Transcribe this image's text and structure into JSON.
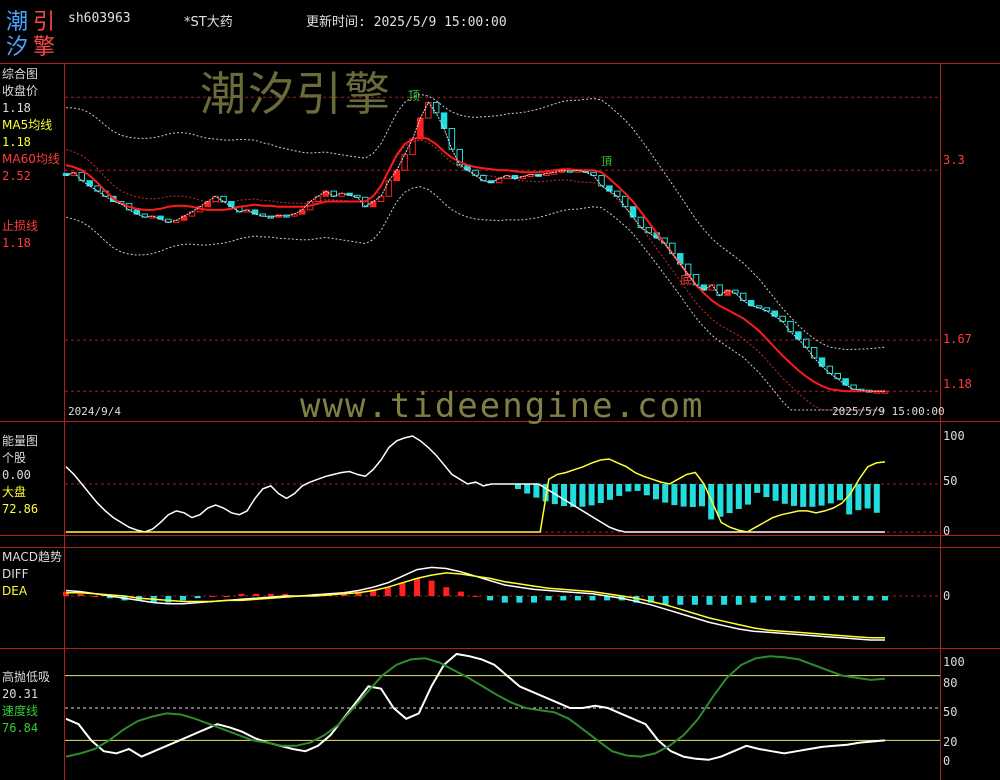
{
  "header": {
    "logo_chars": [
      "潮",
      "引",
      "汐",
      "擎"
    ],
    "symbol": "sh603963",
    "name": "*ST大药",
    "update_label": "更新时间: 2025/5/9 15:00:00"
  },
  "watermark": {
    "cn": "潮汐引擎",
    "url": "www.tideengine.com"
  },
  "main_panel": {
    "title": "综合图",
    "close_label": "收盘价",
    "close_value": "1.18",
    "ma5_label": "MA5均线",
    "ma5_value": "1.18",
    "ma60_label": "MA60均线",
    "ma60_value": "2.52",
    "stop_label": "止损线",
    "stop_value": "1.18",
    "axis_labels": [
      "3.3",
      "1.67",
      "1.18"
    ],
    "date_start": "2024/9/4",
    "date_end": "2025/5/9 15:00:00",
    "marker_top": "顶",
    "marker_bottom": "底",
    "marker_mid": "頂"
  },
  "energy_panel": {
    "title": "能量图",
    "stock_label": "个股",
    "stock_value": "0.00",
    "market_label": "大盘",
    "market_value": "72.86",
    "axis_labels": [
      "100",
      "50",
      "0"
    ]
  },
  "macd_panel": {
    "title": "MACD趋势",
    "diff_label": "DIFF",
    "dea_label": "DEA",
    "axis_labels": [
      "0"
    ]
  },
  "hl_panel": {
    "title": "高抛低吸",
    "value": "20.31",
    "speed_label": "速度线",
    "speed_value": "76.84",
    "axis_labels": [
      "100",
      "80",
      "50",
      "20",
      "0"
    ]
  },
  "colors": {
    "up": "#ff2020",
    "down": "#22dddd",
    "ma60": "#ff1a1a",
    "ma5": "#ffffff",
    "yellow": "#ffff33",
    "green": "#2e8b2e",
    "grid": "#a02020"
  },
  "chart_data": [
    {
      "type": "candlestick",
      "title": "综合图",
      "x_start": "2024/9/4",
      "x_end": "2025/5/9",
      "ylim": [
        1.0,
        4.3
      ],
      "close": [
        3.25,
        3.28,
        3.2,
        3.15,
        3.1,
        3.05,
        3.0,
        2.98,
        2.92,
        2.88,
        2.85,
        2.86,
        2.83,
        2.8,
        2.82,
        2.86,
        2.9,
        2.95,
        3.0,
        3.05,
        3.0,
        2.95,
        2.9,
        2.92,
        2.88,
        2.86,
        2.85,
        2.87,
        2.86,
        2.88,
        2.92,
        3.0,
        3.05,
        3.1,
        3.05,
        3.08,
        3.06,
        3.04,
        2.95,
        3.0,
        3.05,
        3.2,
        3.3,
        3.45,
        3.6,
        3.8,
        3.95,
        3.85,
        3.7,
        3.5,
        3.35,
        3.3,
        3.25,
        3.2,
        3.18,
        3.22,
        3.25,
        3.22,
        3.24,
        3.26,
        3.25,
        3.27,
        3.28,
        3.3,
        3.29,
        3.3,
        3.28,
        3.25,
        3.15,
        3.1,
        3.05,
        2.95,
        2.85,
        2.75,
        2.7,
        2.65,
        2.6,
        2.5,
        2.4,
        2.3,
        2.2,
        2.15,
        2.2,
        2.1,
        2.15,
        2.12,
        2.05,
        2.0,
        1.98,
        1.95,
        1.9,
        1.85,
        1.75,
        1.68,
        1.6,
        1.5,
        1.42,
        1.35,
        1.3,
        1.24,
        1.2,
        1.19,
        1.18,
        1.18,
        1.18
      ],
      "ma60": [
        3.35,
        3.33,
        3.3,
        3.25,
        3.18,
        3.1,
        3.03,
        2.98,
        2.95,
        2.93,
        2.92,
        2.92,
        2.93,
        2.95,
        2.96,
        2.96,
        2.95,
        2.93,
        2.92,
        2.92,
        2.92,
        2.93,
        2.95,
        2.96,
        2.97,
        2.96,
        2.96,
        2.95,
        2.95,
        2.95,
        2.95,
        2.96,
        2.98,
        3.0,
        3.0,
        3.0,
        3.0,
        3.0,
        3.0,
        3.05,
        3.15,
        3.3,
        3.45,
        3.55,
        3.6,
        3.62,
        3.6,
        3.55,
        3.48,
        3.42,
        3.38,
        3.35,
        3.33,
        3.32,
        3.31,
        3.3,
        3.3,
        3.29,
        3.28,
        3.28,
        3.28,
        3.29,
        3.3,
        3.31,
        3.31,
        3.3,
        3.3,
        3.3,
        3.28,
        3.22,
        3.15,
        3.08,
        3.0,
        2.9,
        2.8,
        2.7,
        2.6,
        2.5,
        2.4,
        2.3,
        2.2,
        2.12,
        2.05,
        2.0,
        1.96,
        1.92,
        1.88,
        1.82,
        1.76,
        1.68,
        1.6,
        1.52,
        1.45,
        1.38,
        1.32,
        1.27,
        1.23,
        1.2,
        1.19,
        1.18,
        1.18,
        1.18,
        1.18,
        1.18,
        1.18
      ],
      "upper_band_start": 4.0,
      "stop_line": 1.18,
      "reference_levels": [
        3.3,
        1.67,
        1.18
      ]
    },
    {
      "type": "line",
      "title": "能量图",
      "ylim": [
        0,
        100
      ],
      "series": [
        {
          "name": "个股",
          "values": [
            68,
            60,
            50,
            40,
            30,
            22,
            15,
            10,
            5,
            2,
            0,
            3,
            10,
            18,
            22,
            20,
            15,
            18,
            25,
            28,
            25,
            20,
            18,
            22,
            35,
            45,
            48,
            40,
            35,
            40,
            48,
            52,
            55,
            58,
            60,
            62,
            63,
            60,
            58,
            65,
            75,
            88,
            95,
            98,
            100,
            95,
            88,
            80,
            70,
            60,
            55,
            50,
            52,
            48,
            50,
            50,
            50,
            50,
            50,
            50,
            50,
            45,
            40,
            35,
            30,
            25,
            20,
            15,
            10,
            5,
            2,
            0,
            0,
            0,
            0,
            0,
            0,
            0,
            0,
            0,
            0,
            0,
            0,
            0,
            0,
            0,
            0,
            0,
            0,
            0,
            0,
            0,
            0,
            0,
            0,
            0,
            0,
            0,
            0,
            0,
            0,
            0,
            0,
            0,
            0
          ]
        },
        {
          "name": "大盘",
          "values": [
            0,
            0,
            0,
            0,
            0,
            0,
            0,
            0,
            0,
            0,
            0,
            0,
            0,
            0,
            0,
            0,
            0,
            0,
            0,
            0,
            0,
            0,
            0,
            0,
            0,
            0,
            0,
            0,
            0,
            0,
            0,
            0,
            0,
            0,
            0,
            0,
            0,
            0,
            0,
            0,
            0,
            0,
            0,
            0,
            0,
            0,
            0,
            0,
            0,
            0,
            0,
            0,
            0,
            0,
            0,
            0,
            55,
            60,
            62,
            65,
            68,
            72,
            75,
            76,
            72,
            68,
            62,
            58,
            55,
            52,
            50,
            55,
            60,
            62,
            50,
            30,
            10,
            5,
            2,
            0,
            5,
            10,
            15,
            18,
            20,
            22,
            22,
            20,
            22,
            25,
            30,
            40,
            55,
            68,
            72,
            73
          ]
        }
      ]
    },
    {
      "type": "line",
      "title": "MACD趋势",
      "series": [
        {
          "name": "DIFF",
          "values": [
            0.05,
            0.04,
            0.02,
            0.0,
            -0.02,
            -0.04,
            -0.06,
            -0.07,
            -0.07,
            -0.06,
            -0.05,
            -0.04,
            -0.03,
            -0.02,
            -0.01,
            0.0,
            0.0,
            0.01,
            0.02,
            0.03,
            0.05,
            0.08,
            0.12,
            0.18,
            0.24,
            0.26,
            0.25,
            0.22,
            0.18,
            0.14,
            0.1,
            0.08,
            0.06,
            0.05,
            0.04,
            0.03,
            0.02,
            0.0,
            -0.02,
            -0.05,
            -0.08,
            -0.12,
            -0.16,
            -0.2,
            -0.24,
            -0.27,
            -0.3,
            -0.32,
            -0.33,
            -0.34,
            -0.35,
            -0.36,
            -0.37,
            -0.38,
            -0.39,
            -0.4,
            -0.4
          ]
        },
        {
          "name": "DEA",
          "values": [
            0.03,
            0.03,
            0.02,
            0.01,
            0.0,
            -0.02,
            -0.03,
            -0.04,
            -0.05,
            -0.05,
            -0.05,
            -0.04,
            -0.04,
            -0.03,
            -0.02,
            -0.01,
            0.0,
            0.0,
            0.01,
            0.02,
            0.03,
            0.05,
            0.08,
            0.12,
            0.16,
            0.19,
            0.21,
            0.2,
            0.18,
            0.16,
            0.13,
            0.11,
            0.09,
            0.07,
            0.06,
            0.05,
            0.04,
            0.02,
            0.0,
            -0.02,
            -0.05,
            -0.08,
            -0.12,
            -0.16,
            -0.2,
            -0.23,
            -0.26,
            -0.29,
            -0.31,
            -0.32,
            -0.33,
            -0.34,
            -0.35,
            -0.36,
            -0.37,
            -0.38,
            -0.38
          ]
        }
      ]
    },
    {
      "type": "line",
      "title": "高抛低吸",
      "ylim": [
        0,
        100
      ],
      "series": [
        {
          "name": "高抛低吸",
          "values": [
            40,
            35,
            20,
            10,
            8,
            12,
            5,
            10,
            15,
            20,
            25,
            30,
            35,
            32,
            28,
            22,
            18,
            15,
            12,
            10,
            15,
            25,
            40,
            55,
            70,
            68,
            50,
            40,
            45,
            70,
            90,
            100,
            98,
            95,
            90,
            80,
            70,
            65,
            60,
            55,
            50,
            50,
            52,
            50,
            45,
            40,
            35,
            20,
            10,
            5,
            3,
            2,
            5,
            10,
            15,
            12,
            10,
            8,
            10,
            12,
            14,
            15,
            16,
            18,
            19,
            20
          ]
        },
        {
          "name": "速度线",
          "values": [
            5,
            8,
            12,
            20,
            30,
            38,
            42,
            45,
            44,
            40,
            35,
            30,
            25,
            20,
            18,
            15,
            15,
            18,
            25,
            35,
            50,
            65,
            80,
            90,
            95,
            96,
            92,
            85,
            78,
            70,
            62,
            55,
            50,
            48,
            46,
            40,
            30,
            20,
            10,
            6,
            5,
            8,
            15,
            25,
            40,
            60,
            78,
            90,
            96,
            98,
            97,
            95,
            90,
            85,
            80,
            78,
            76,
            77
          ]
        }
      ]
    }
  ]
}
